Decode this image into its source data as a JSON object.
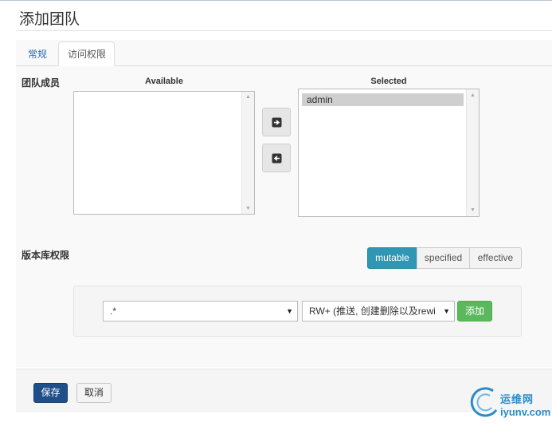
{
  "page": {
    "title": "添加团队"
  },
  "tabs": [
    {
      "label": "常规",
      "active": false
    },
    {
      "label": "访问权限",
      "active": true
    }
  ],
  "members": {
    "label": "团队成员",
    "available_title": "Available",
    "selected_title": "Selected",
    "available_items": [],
    "selected_items": [
      "admin"
    ],
    "move_right_icon": "arrow-right-box-icon",
    "move_left_icon": "arrow-left-box-icon"
  },
  "repo_permissions": {
    "label": "版本库权限",
    "modes": [
      {
        "label": "mutable",
        "active": true
      },
      {
        "label": "specified",
        "active": false
      },
      {
        "label": "effective",
        "active": false
      }
    ],
    "repo_pattern": ".*",
    "permission_value": "RW+ (推送, 创建删除以及rewi",
    "add_label": "添加"
  },
  "footer": {
    "save_label": "保存",
    "cancel_label": "取消"
  },
  "watermark": {
    "cn": "运维网",
    "en": "iyunv.com"
  },
  "colors": {
    "accent": "#2f96b4",
    "primary": "#1f4f8a",
    "success": "#5cb85c",
    "link": "#2b6cb0"
  }
}
